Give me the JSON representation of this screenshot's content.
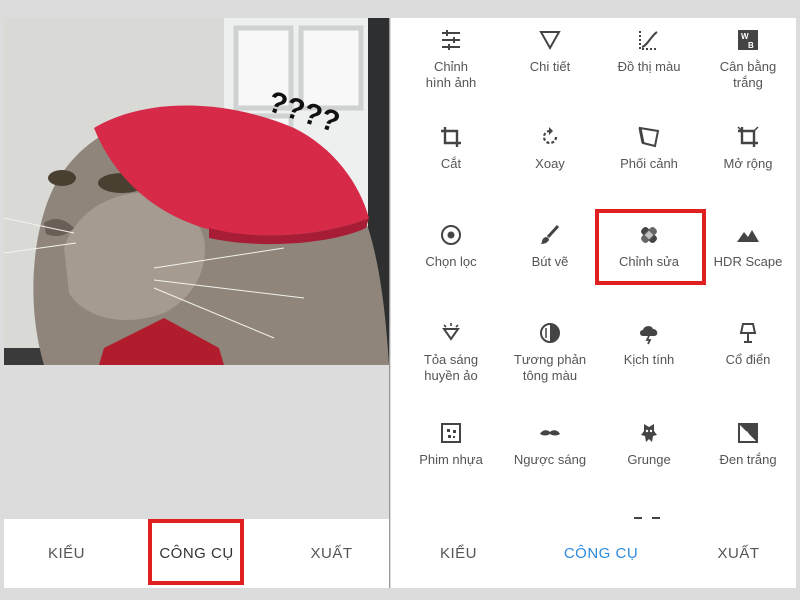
{
  "left_panel": {
    "photo_overlay_text": "????",
    "bottom_tabs": [
      {
        "label": "KIỂU"
      },
      {
        "label": "CÔNG CỤ"
      },
      {
        "label": "XUẤT"
      }
    ]
  },
  "right_panel": {
    "tools": [
      {
        "label": "Chỉnh\nhình ảnh",
        "icon": "tune-sliders-icon"
      },
      {
        "label": "Chi tiết",
        "icon": "triangle-icon"
      },
      {
        "label": "Đồ thị màu",
        "icon": "curves-icon"
      },
      {
        "label": "Cân bằng\ntrắng",
        "icon": "white-balance-icon"
      },
      {
        "label": "Cắt",
        "icon": "crop-icon"
      },
      {
        "label": "Xoay",
        "icon": "rotate-icon"
      },
      {
        "label": "Phối cảnh",
        "icon": "perspective-icon"
      },
      {
        "label": "Mở rộng",
        "icon": "expand-icon"
      },
      {
        "label": "Chọn lọc",
        "icon": "selective-icon"
      },
      {
        "label": "Bút vẽ",
        "icon": "brush-icon"
      },
      {
        "label": "Chỉnh sửa",
        "icon": "healing-bandage-icon"
      },
      {
        "label": "HDR Scape",
        "icon": "mountains-icon"
      },
      {
        "label": "Tỏa sáng\nhuyền ảo",
        "icon": "diamond-glow-icon"
      },
      {
        "label": "Tương phản\ntông màu",
        "icon": "tonal-contrast-icon"
      },
      {
        "label": "Kịch tính",
        "icon": "cloud-lightning-icon"
      },
      {
        "label": "Cổ điển",
        "icon": "lamp-icon"
      },
      {
        "label": "Phim nhựa",
        "icon": "film-grain-icon"
      },
      {
        "label": "Ngược sáng",
        "icon": "mustache-icon"
      },
      {
        "label": "Grunge",
        "icon": "grunge-icon"
      },
      {
        "label": "Đen trắng",
        "icon": "black-white-icon"
      }
    ],
    "bottom_tabs": [
      {
        "label": "KIỂU"
      },
      {
        "label": "CÔNG CỤ"
      },
      {
        "label": "XUẤT"
      }
    ]
  },
  "colors": {
    "highlight": "#e02020",
    "active_tab": "#2c8be0"
  }
}
